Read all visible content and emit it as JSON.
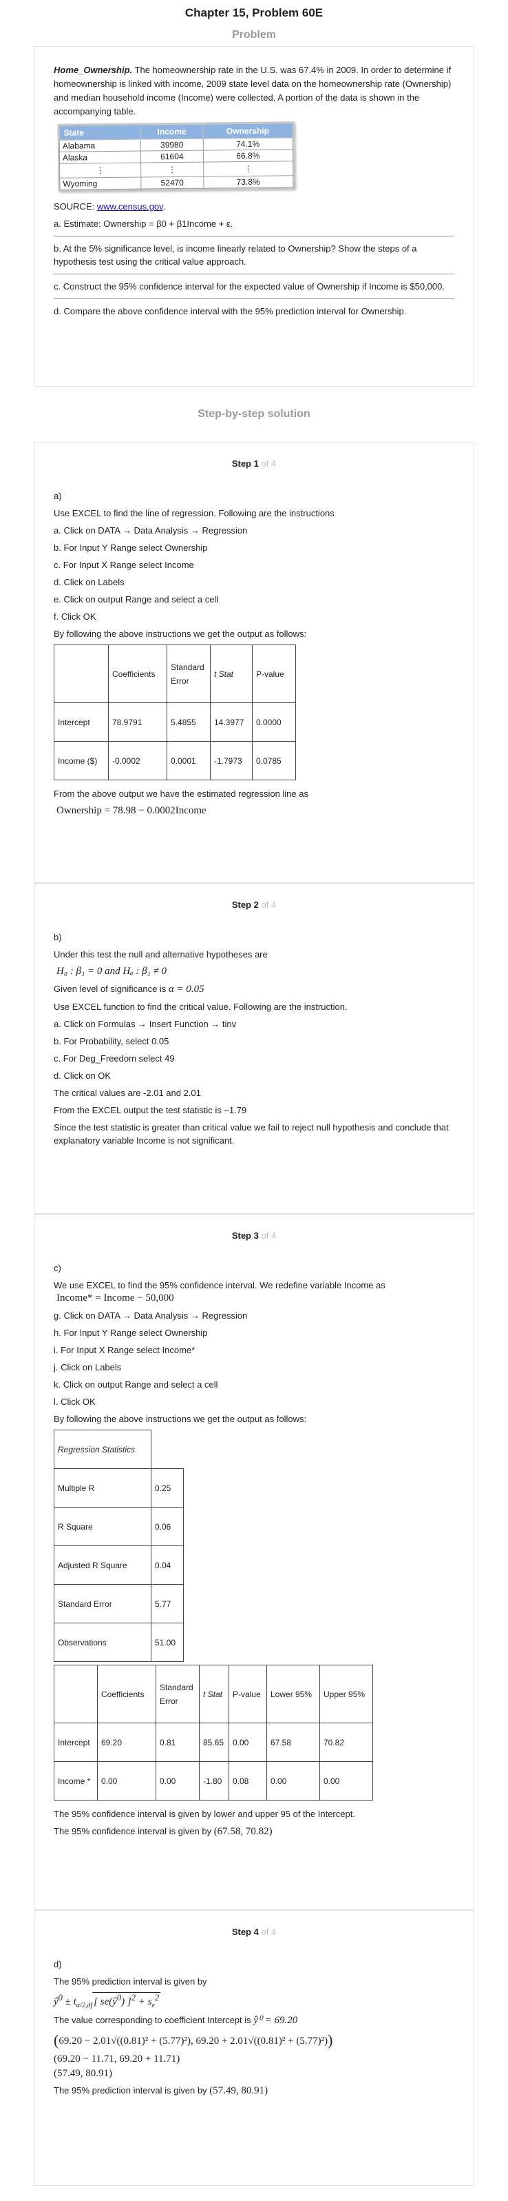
{
  "header": {
    "title": "Chapter 15, Problem 60E",
    "problem_label": "Problem",
    "solution_label": "Step-by-step solution"
  },
  "problem": {
    "intro_bold": "Home_Ownership.",
    "intro_rest": " The homeownership rate in the U.S. was 67.4% in 2009. In order to determine if homeownership is linked with income, 2009 state level data on the homeownership rate (Ownership) and median household income (Income) were collected. A portion of the data is shown in the accompanying table.",
    "table": {
      "headers": [
        "State",
        "Income",
        "Ownership"
      ],
      "rows": [
        [
          "Alabama",
          "39980",
          "74.1%"
        ],
        [
          "Alaska",
          "61604",
          "66.8%"
        ],
        [
          "⋮",
          "⋮",
          "⋮"
        ],
        [
          "Wyoming",
          "52470",
          "73.8%"
        ]
      ]
    },
    "source_label": "SOURCE: ",
    "source_link": "www.census.gov",
    "source_end": ".",
    "part_a": "a. Estimate: Ownership = β0 + β1Income + ε.",
    "part_b": "b. At the 5% significance level, is income linearly related to Ownership? Show the steps of a hypothesis test using the critical value approach.",
    "part_c": "c. Construct the 95% confidence interval for the expected value of Ownership if Income is $50,000.",
    "part_d": "d. Compare the above confidence interval with the 95% prediction interval for Ownership."
  },
  "steps": {
    "step_word": "Step",
    "of_word": "of",
    "total": "4",
    "s1": {
      "num": "1",
      "label": "a)",
      "l1": "Use EXCEL to find the line of regression. Following are the instructions",
      "l2": "a. Click on DATA → Data Analysis → Regression",
      "l3": "b. For Input Y Range select Ownership",
      "l4": "c. For Input X Range select Income",
      "l5": "d. Click on Labels",
      "l6": "e. Click on output Range and select a cell",
      "l7": "f. Click OK",
      "l8": "By following the above instructions we get the output as follows:",
      "table": {
        "headers": [
          "",
          "Coefficients",
          "Standard Error",
          "t Stat",
          "P-value"
        ],
        "rows": [
          [
            "Intercept",
            "78.9791",
            "5.4855",
            "14.3977",
            "0.0000"
          ],
          [
            "Income ($)",
            "-0.0002",
            "0.0001",
            "-1.7973",
            "0.0785"
          ]
        ]
      },
      "l9": "From the above output we have the estimated regression line as",
      "eq": "Ownership = 78.98 − 0.0002Income"
    },
    "s2": {
      "num": "2",
      "label": "b)",
      "l1": "Under this test the null and alternative hypotheses are",
      "hyp": "H₀ : β₁ = 0  and  Hₐ : β₁ ≠ 0",
      "l2": "Given level of significance is ",
      "alpha": "α = 0.05",
      "l3": "Use EXCEL function to find the critical value. Following are the instruction.",
      "l4": "a. Click on Formulas → Insert Function → tinv",
      "l5": "b. For Probability, select 0.05",
      "l6": "c. For Deg_Freedom select 49",
      "l7": "d. Click on OK",
      "l8": "The critical values are -2.01 and 2.01",
      "l9": "From the EXCEL output the test statistic is −1.79",
      "l10": "Since the test statistic is greater than critical value we fail to reject null hypothesis and conclude that explanatory variable Income is not significant."
    },
    "s3": {
      "num": "3",
      "label": "c)",
      "l1": "We use EXCEL to find the 95% confidence interval. We redefine variable Income as",
      "eq": "Income* = Income − 50,000",
      "l2": "g. Click on DATA → Data Analysis → Regression",
      "l3": "h. For Input Y Range select Ownership",
      "l4": "i. For Input X Range select Income*",
      "l5": "j. Click on Labels",
      "l6": "k. Click on output Range and select a cell",
      "l7": "l. Click OK",
      "l8": "By following the above instructions we get the output as follows:",
      "stats_title": "Regression Statistics",
      "stats": [
        [
          "Multiple R",
          "0.25"
        ],
        [
          "R Square",
          "0.06"
        ],
        [
          "Adjusted R Square",
          "0.04"
        ],
        [
          "Standard Error",
          "5.77"
        ],
        [
          "Observations",
          "51.00"
        ]
      ],
      "coef_headers": [
        "",
        "Coefficients",
        "Standard Error",
        "t Stat",
        "P-value",
        "Lower 95%",
        "Upper 95%"
      ],
      "coef_rows": [
        [
          "Intercept",
          "69.20",
          "0.81",
          "85.65",
          "0.00",
          "67.58",
          "70.82"
        ],
        [
          "Income *",
          "0.00",
          "0.00",
          "-1.80",
          "0.08",
          "0.00",
          "0.00"
        ]
      ],
      "l9": "The 95% confidence interval is given by lower and upper 95 of the Intercept.",
      "l10": "The 95% confidence interval is given by ",
      "ci": "(67.58, 70.82)"
    },
    "s4": {
      "num": "4",
      "label": "d)",
      "l1": "The 95% prediction interval is given by",
      "l2": "The value corresponding to coefficient Intercept is ",
      "yhat": "ŷ⁰ = 69.20",
      "calc1": "69.20 − 2.01√((0.81)² + (5.77)²), 69.20 + 2.01√((0.81)² + (5.77)²)",
      "calc2": "(69.20 − 11.71, 69.20 + 11.71)",
      "calc3": "(57.49, 80.91)",
      "l3": "The 95% prediction interval is given by ",
      "pi": "(57.49, 80.91)"
    }
  }
}
